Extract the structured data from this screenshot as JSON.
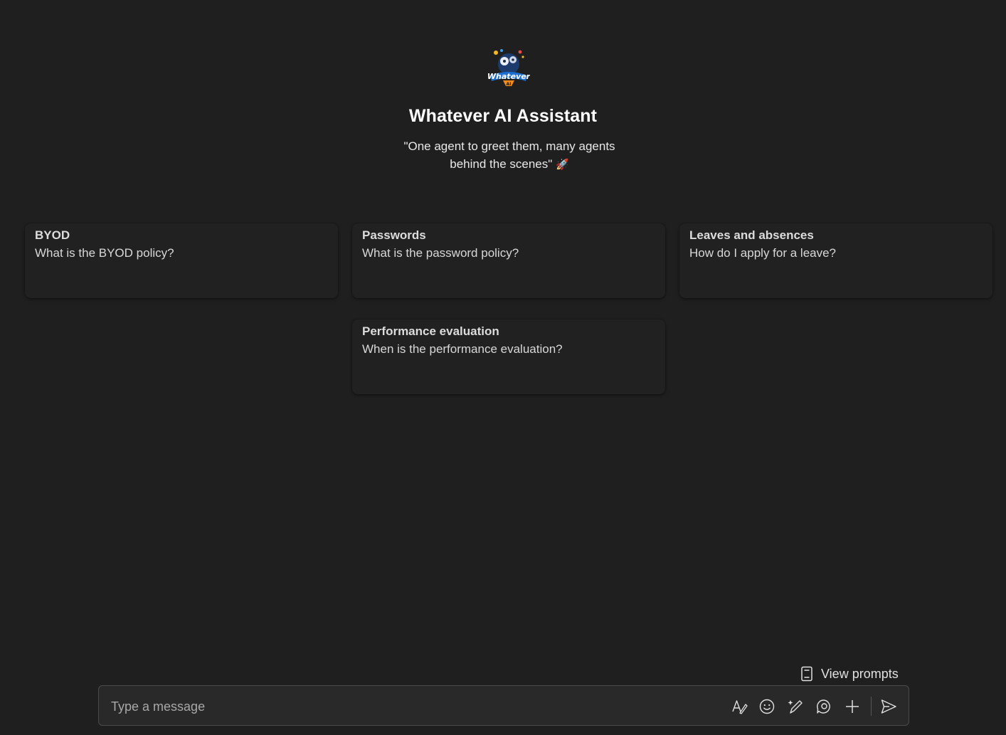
{
  "app": {
    "title": "Whatever AI Assistant",
    "tagline_line1": "\"One agent to greet them, many agents",
    "tagline_line2": "behind the scenes\"",
    "tagline_emoji": "🚀",
    "logo_text_main": "Whatever",
    "logo_text_sub": "AI"
  },
  "suggestions": [
    {
      "title": "BYOD",
      "prompt": "What is the BYOD policy?"
    },
    {
      "title": "Passwords",
      "prompt": "What is the password policy?"
    },
    {
      "title": "Leaves and absences",
      "prompt": "How do I apply for a leave?"
    },
    {
      "title": "Performance evaluation",
      "prompt": "When is the performance evaluation?"
    }
  ],
  "prompts": {
    "view_label": "View prompts",
    "icon": "notebook-icon"
  },
  "composer": {
    "placeholder": "Type a message",
    "value": "",
    "tools": [
      "format-icon",
      "emoji-icon",
      "copilot-pen-icon",
      "loop-icon",
      "plus-icon",
      "send-icon"
    ]
  },
  "colors": {
    "background": "#1f1f1f",
    "composer_background": "#292929",
    "composer_border": "#4a4a4a",
    "text_primary": "#ffffff",
    "text_secondary": "#d8d8d8"
  }
}
